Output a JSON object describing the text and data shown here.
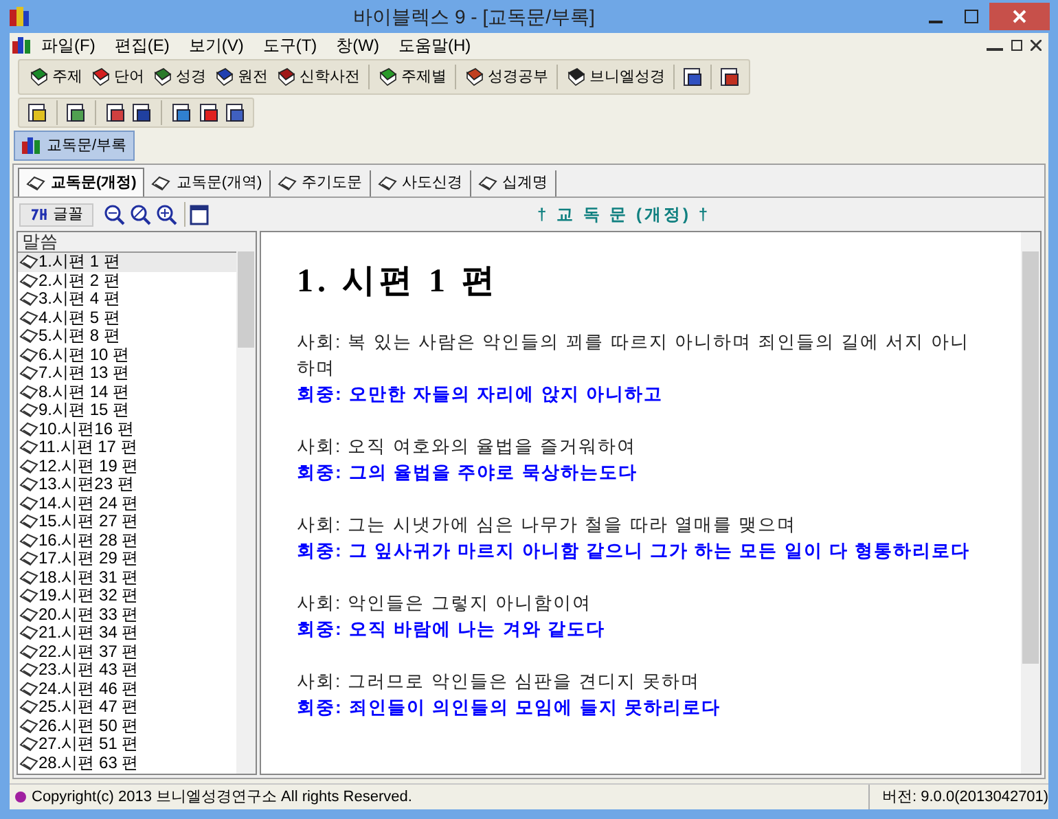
{
  "window": {
    "title": "바이블렉스 9 - [교독문/부록]"
  },
  "menu": [
    "파일(F)",
    "편집(E)",
    "보기(V)",
    "도구(T)",
    "창(W)",
    "도움말(H)"
  ],
  "toolbar": [
    {
      "label": "주제",
      "kind": "text"
    },
    {
      "label": "단어",
      "kind": "text"
    },
    {
      "label": "성경",
      "kind": "text"
    },
    {
      "label": "원전",
      "kind": "text"
    },
    {
      "label": "신학사전",
      "kind": "text"
    },
    {
      "label": "주제별",
      "kind": "text"
    },
    {
      "label": "성경공부",
      "kind": "text"
    },
    {
      "label": "브니엘성경",
      "kind": "text"
    }
  ],
  "document_tab": {
    "label": "교독문/부록"
  },
  "tabs": [
    {
      "label": "교독문(개정)",
      "selected": true
    },
    {
      "label": "교독문(개역)",
      "selected": false
    },
    {
      "label": "주기도문",
      "selected": false
    },
    {
      "label": "사도신경",
      "selected": false
    },
    {
      "label": "십계명",
      "selected": false
    }
  ],
  "font_button": {
    "label": "글꼴"
  },
  "heading": "† 교 독 문 (개정) †",
  "list": {
    "header": "말씀",
    "items": [
      {
        "label": "1.시편 1 편",
        "selected": true
      },
      {
        "label": "2.시편 2 편",
        "selected": false
      },
      {
        "label": "3.시편 4 편",
        "selected": false
      },
      {
        "label": "4.시편 5 편",
        "selected": false
      },
      {
        "label": "5.시편 8 편",
        "selected": false
      },
      {
        "label": "6.시편 10 편",
        "selected": false
      },
      {
        "label": "7.시편 13 편",
        "selected": false
      },
      {
        "label": "8.시편 14 편",
        "selected": false
      },
      {
        "label": "9.시편 15 편",
        "selected": false
      },
      {
        "label": "10.시편16 편",
        "selected": false
      },
      {
        "label": "11.시편 17 편",
        "selected": false
      },
      {
        "label": "12.시편 19 편",
        "selected": false
      },
      {
        "label": "13.시편23 편",
        "selected": false
      },
      {
        "label": "14.시편 24 편",
        "selected": false
      },
      {
        "label": "15.시편 27 편",
        "selected": false
      },
      {
        "label": "16.시편 28 편",
        "selected": false
      },
      {
        "label": "17.시편 29 편",
        "selected": false
      },
      {
        "label": "18.시편 31 편",
        "selected": false
      },
      {
        "label": "19.시편 32 편",
        "selected": false
      },
      {
        "label": "20.시편 33 편",
        "selected": false
      },
      {
        "label": "21.시편 34 편",
        "selected": false
      },
      {
        "label": "22.시편 37 편",
        "selected": false
      },
      {
        "label": "23.시편 43 편",
        "selected": false
      },
      {
        "label": "24.시편 46 편",
        "selected": false
      },
      {
        "label": "25.시편 47 편",
        "selected": false
      },
      {
        "label": "26.시편 50 편",
        "selected": false
      },
      {
        "label": "27.시편 51 편",
        "selected": false
      },
      {
        "label": "28.시편 63 편",
        "selected": false
      }
    ]
  },
  "content": {
    "title": "1. 시편 1 편",
    "stanzas": [
      [
        {
          "kind": "leader",
          "text": "사회: 복 있는 사람은 악인들의 꾀를 따르지 아니하며 죄인들의 길에 서지 아니하며"
        },
        {
          "kind": "congregation",
          "text": "회중: 오만한 자들의 자리에 앉지 아니하고"
        }
      ],
      [
        {
          "kind": "leader",
          "text": "사회: 오직 여호와의 율법을 즐거워하여"
        },
        {
          "kind": "congregation",
          "text": "회중: 그의 율법을 주야로 묵상하는도다"
        }
      ],
      [
        {
          "kind": "leader",
          "text": "사회: 그는 시냇가에 심은 나무가 철을 따라 열매를 맺으며"
        },
        {
          "kind": "congregation",
          "text": "회중: 그 잎사귀가 마르지 아니함 같으니 그가 하는 모든 일이 다 형통하리로다"
        }
      ],
      [
        {
          "kind": "leader",
          "text": "사회: 악인들은 그렇지 아니함이여"
        },
        {
          "kind": "congregation",
          "text": "회중: 오직 바람에 나는 겨와 같도다"
        }
      ],
      [
        {
          "kind": "leader",
          "text": "사회: 그러므로 악인들은 심판을 견디지 못하며"
        },
        {
          "kind": "congregation",
          "text": "회중: 죄인들이 의인들의 모임에 들지 못하리로다"
        }
      ]
    ]
  },
  "status_bar": {
    "copyright": "Copyright(c) 2013 브니엘성경연구소 All rights Reserved.",
    "version": "버전: 9.0.0(2013042701)"
  }
}
